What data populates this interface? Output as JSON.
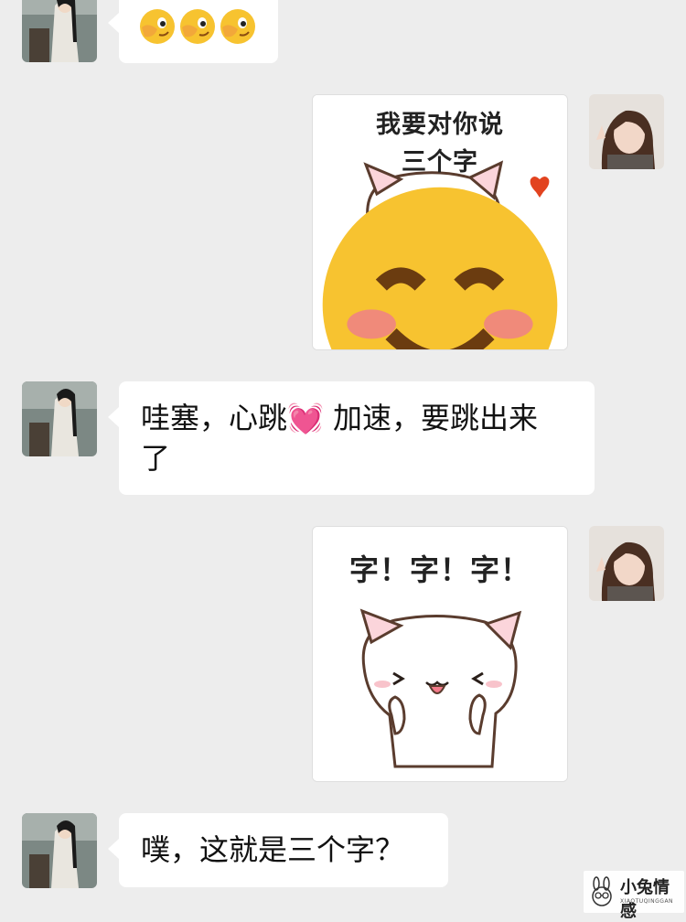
{
  "messages": {
    "m1": {
      "sender": "left",
      "emoji": [
        "face-with-hand-over-eye",
        "face-with-hand-over-eye",
        "face-with-hand-over-eye"
      ]
    },
    "m2": {
      "sender": "right",
      "sticker_line1": "我要对你说",
      "sticker_line2": "三个字",
      "sticker_icon": "smiling-face-emoji"
    },
    "m3": {
      "sender": "left",
      "text_a": "哇塞，心跳",
      "heart": "💓",
      "text_b": " 加速，要跳出来",
      "text_c": "了"
    },
    "m4": {
      "sender": "right",
      "sticker_text": "字！字！字！"
    },
    "m5": {
      "sender": "left",
      "text": "噗，这就是三个字？"
    }
  },
  "watermark": {
    "main": "小兔情感",
    "sub": "XIAOTUQINGGAN"
  },
  "colors": {
    "background": "#ededed",
    "bubble": "#ffffff",
    "text": "#111111"
  }
}
